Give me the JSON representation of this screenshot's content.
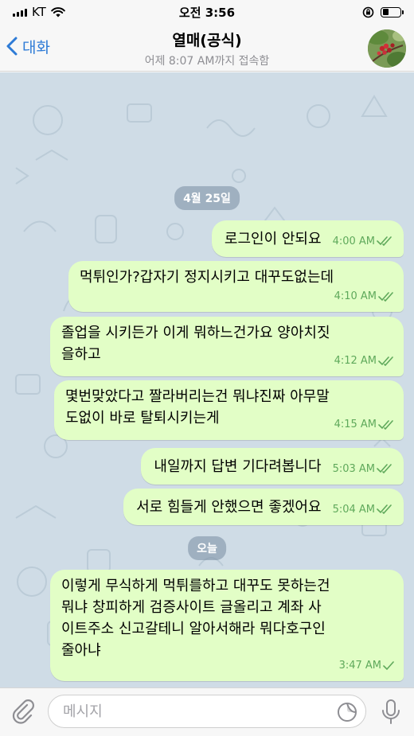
{
  "status_bar": {
    "carrier": "KT",
    "time": "오전 3:56",
    "battery_level": 0.35
  },
  "header": {
    "back_label": "대화",
    "title": "열매(공식)",
    "subtitle": "어제 8:07 AM까지 접속함",
    "avatar_icon": "avatar-photo-berries"
  },
  "date_separators": [
    "4월 25일",
    "오늘"
  ],
  "messages": [
    {
      "text": "로그인이 안되요",
      "time": "4:00 AM",
      "status": "read"
    },
    {
      "text": "먹튀인가?갑자기 정지시키고 대꾸도없는데",
      "time": "4:10 AM",
      "status": "read"
    },
    {
      "text": "졸업을 시키든가 이게 뭐하느건가요 양아치짓\n을하고",
      "time": "4:12 AM",
      "status": "read"
    },
    {
      "text": "몇번맞았다고 짤라버리는건 뭐냐진짜 아무말\n도없이 바로 탈퇴시키는게",
      "time": "4:15 AM",
      "status": "read"
    },
    {
      "text": "내일까지 답변 기다려봅니다",
      "time": "5:03 AM",
      "status": "read"
    },
    {
      "text": "서로 힘들게 안했으면 좋겠어요",
      "time": "5:04 AM",
      "status": "read"
    },
    {
      "text": "이렇게 무식하게 먹튀를하고 대꾸도 못하는건\n뭐냐 창피하게 검증사이트 글올리고 계좌 사\n이트주소 신고갈테니 알아서해라 뭐다호구인\n줄아냐",
      "time": "3:47 AM",
      "status": "delivered"
    }
  ],
  "input": {
    "placeholder": "메시지",
    "value": ""
  },
  "colors": {
    "accent": "#2e7bd6",
    "bubble_out": "#e2fec6",
    "check": "#5fa95b",
    "chat_bg": "#cfdce6"
  }
}
